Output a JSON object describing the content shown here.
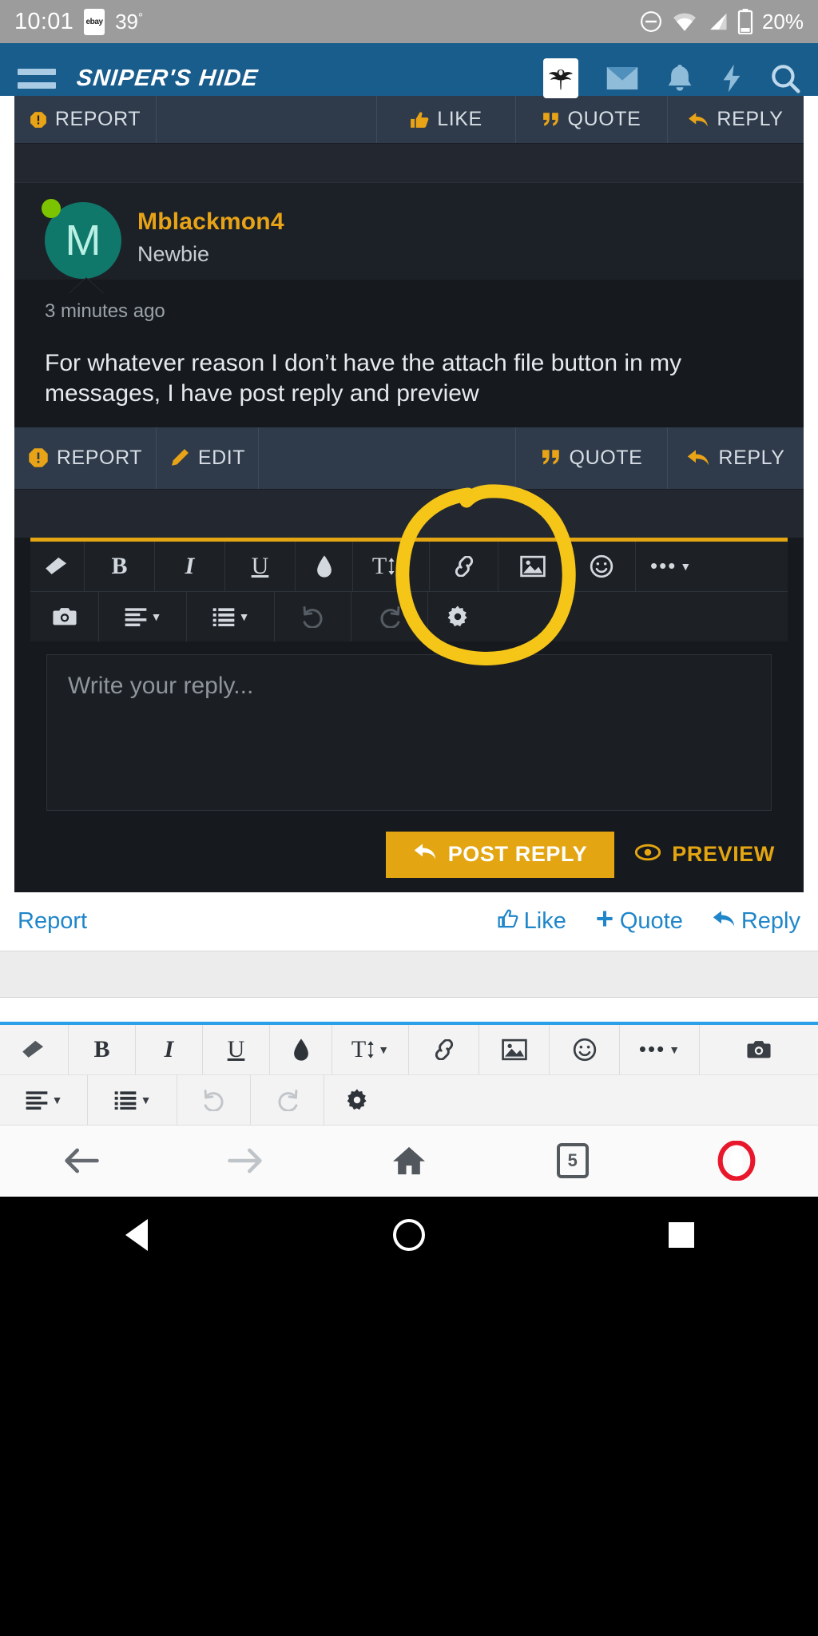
{
  "statusbar": {
    "time": "10:01",
    "app_badge": "ebay",
    "temperature": "39",
    "degree": "°",
    "battery": "20%",
    "icons": [
      "dnd-icon",
      "wifi-icon",
      "signal-icon",
      "battery-icon"
    ]
  },
  "header": {
    "brand": "SNIPER'S HIDE",
    "menu_icon": "hamburger-menu-icon",
    "icons": [
      "site-logo-icon",
      "inbox-icon",
      "alerts-icon",
      "whats-new-icon",
      "search-icon"
    ]
  },
  "clipped_action_bar": {
    "report": "REPORT",
    "like": "LIKE",
    "quote": "QUOTE",
    "reply": "REPLY"
  },
  "post": {
    "username": "Mblackmon4",
    "user_title": "Newbie",
    "avatar_initial": "M",
    "online_status": "online",
    "timestamp": "3 minutes ago",
    "message": "For whatever reason I don’t have the attach file button in my messages, I have post reply and preview",
    "actions": {
      "report": "REPORT",
      "edit": "EDIT",
      "quote": "QUOTE",
      "reply": "REPLY"
    }
  },
  "editor": {
    "placeholder": "Write your reply...",
    "accent_color": "#e3a511",
    "toolbar_row1": [
      {
        "name": "remove-formatting-icon",
        "label": "eraser"
      },
      {
        "name": "bold-icon",
        "label": "B"
      },
      {
        "name": "italic-icon",
        "label": "I"
      },
      {
        "name": "underline-icon",
        "label": "U"
      },
      {
        "name": "text-color-icon",
        "label": "droplet"
      },
      {
        "name": "font-size-icon",
        "label": "T"
      },
      {
        "name": "insert-link-icon",
        "label": "link"
      },
      {
        "name": "insert-image-icon",
        "label": "image"
      },
      {
        "name": "insert-smilie-icon",
        "label": "smiley"
      },
      {
        "name": "more-options-icon",
        "label": "ellipsis"
      }
    ],
    "toolbar_row2": [
      {
        "name": "camera-icon",
        "label": "camera"
      },
      {
        "name": "text-align-icon",
        "label": "align"
      },
      {
        "name": "list-icon",
        "label": "list"
      },
      {
        "name": "undo-icon",
        "label": "undo"
      },
      {
        "name": "redo-icon",
        "label": "redo"
      },
      {
        "name": "editor-settings-icon",
        "label": "gear"
      }
    ],
    "post_button": "POST REPLY",
    "preview_button": "PREVIEW"
  },
  "annotation": {
    "shape": "hand-drawn-circle",
    "color": "#f5c518",
    "target": "insert-link / insert-image / insert-smilie toolbar icons"
  },
  "white_links": {
    "report": "Report",
    "like": "Like",
    "quote": "Quote",
    "reply": "Reply",
    "link_color": "#1f86c9"
  },
  "keyboard_toolbar": {
    "accent_color": "#2aa0e8",
    "row1": [
      {
        "name": "remove-formatting-icon",
        "label": "eraser"
      },
      {
        "name": "bold-icon",
        "label": "B"
      },
      {
        "name": "italic-icon",
        "label": "I"
      },
      {
        "name": "underline-icon",
        "label": "U"
      },
      {
        "name": "text-color-icon",
        "label": "droplet"
      },
      {
        "name": "font-size-icon",
        "label": "T"
      },
      {
        "name": "insert-link-icon",
        "label": "link"
      },
      {
        "name": "insert-image-icon",
        "label": "image"
      },
      {
        "name": "insert-smilie-icon",
        "label": "smiley"
      },
      {
        "name": "more-options-icon",
        "label": "ellipsis"
      },
      {
        "name": "camera-icon",
        "label": "camera"
      }
    ],
    "row2": [
      {
        "name": "text-align-icon",
        "label": "align"
      },
      {
        "name": "list-icon",
        "label": "list"
      },
      {
        "name": "undo-icon",
        "label": "undo"
      },
      {
        "name": "redo-icon",
        "label": "redo"
      },
      {
        "name": "editor-settings-icon",
        "label": "gear"
      }
    ]
  },
  "browser_nav": {
    "back": "back-arrow-icon",
    "forward": "forward-arrow-icon",
    "home": "home-icon",
    "tab_count": "5",
    "opera_menu": "opera-logo-icon"
  },
  "system_nav": {
    "back": "android-back-icon",
    "home": "android-home-icon",
    "recents": "android-recents-icon"
  }
}
